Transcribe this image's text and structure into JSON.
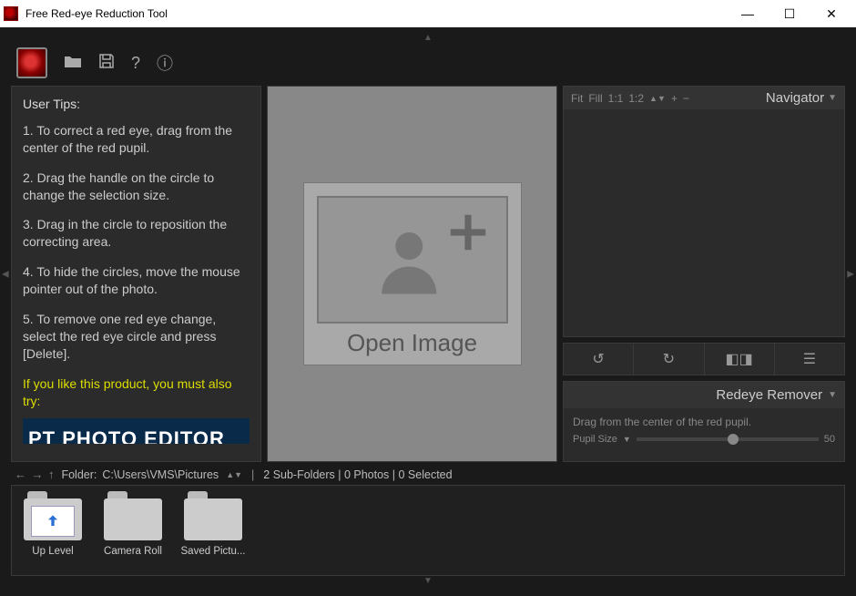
{
  "window": {
    "title": "Free Red-eye Reduction Tool"
  },
  "tips": {
    "heading": "User Tips:",
    "items": [
      "1. To correct a red eye, drag from the center of the red pupil.",
      "2. Drag the handle on the circle to change the selection size.",
      "3. Drag in the circle to reposition the correcting area.",
      "4. To hide the circles, move the mouse pointer out of the photo.",
      "5. To remove one red eye change, select the red eye circle and press [Delete]."
    ],
    "promo": "If you like this product, you must also try:",
    "promo_banner": "PT PHOTO EDITOR"
  },
  "canvas": {
    "open_label": "Open Image"
  },
  "navigator": {
    "zoom_fit": "Fit",
    "zoom_fill": "Fill",
    "zoom_1_1": "1:1",
    "zoom_1_2": "1:2",
    "title": "Navigator"
  },
  "remover": {
    "title": "Redeye Remover",
    "hint": "Drag from the center of the red pupil.",
    "pupil_label": "Pupil Size",
    "pupil_value": "50"
  },
  "folder": {
    "label": "Folder:",
    "path": "C:\\Users\\VMS\\Pictures",
    "meta": "2 Sub-Folders | 0 Photos | 0 Selected"
  },
  "thumbs": {
    "up": "Up Level",
    "roll": "Camera Roll",
    "saved": "Saved Pictu..."
  }
}
